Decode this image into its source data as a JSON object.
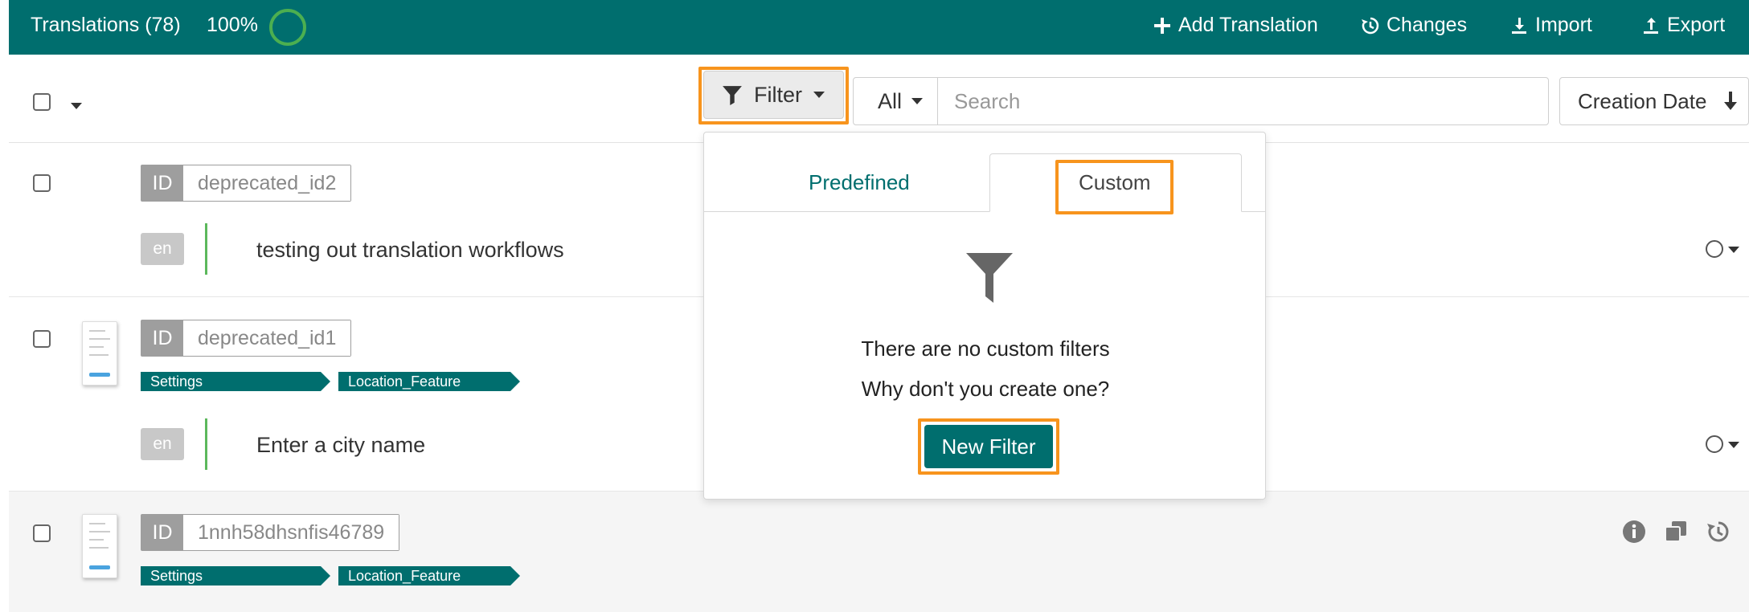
{
  "header": {
    "title": "Translations (78)",
    "progress_label": "100%",
    "progress": 1.0,
    "actions": {
      "add": "Add Translation",
      "changes": "Changes",
      "import": "Import",
      "export": "Export"
    }
  },
  "toolbar": {
    "filter_label": "Filter",
    "scope_label": "All",
    "search_placeholder": "Search",
    "sort_label": "Creation Date"
  },
  "dropdown": {
    "tabs": [
      "Predefined",
      "Custom"
    ],
    "active_tab": "Custom",
    "empty_title": "There are no custom filters",
    "empty_subtitle": "Why don't you create one?",
    "new_filter_label": "New Filter"
  },
  "rows": [
    {
      "id_label": "ID",
      "id": "deprecated_id2",
      "lang": "en",
      "text": "testing out translation workflows",
      "tags": []
    },
    {
      "id_label": "ID",
      "id": "deprecated_id1",
      "lang": "en",
      "text": "Enter a city name",
      "tags": [
        "Settings",
        "Location_Feature"
      ]
    },
    {
      "id_label": "ID",
      "id": "1nnh58dhsnfis46789",
      "tags": [
        "Settings",
        "Location_Feature"
      ]
    }
  ],
  "colors": {
    "brand": "#006e6e",
    "highlight": "#f7941d",
    "progress_ring": "#4caf50",
    "lang_bar": "#5cb85c"
  }
}
